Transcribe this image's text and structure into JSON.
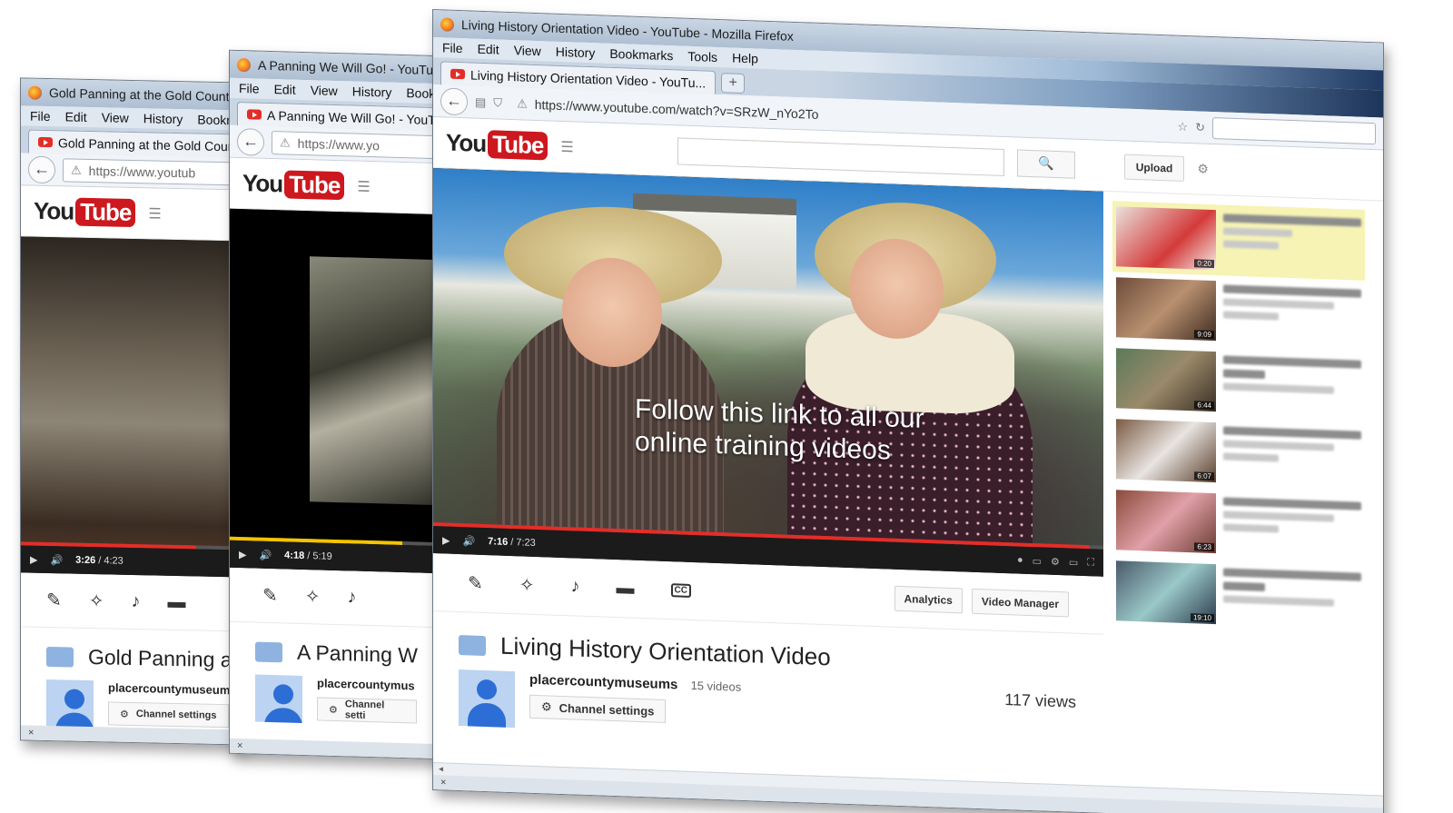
{
  "colors": {
    "youtube_red": "#e52d27",
    "titlebar": "#bfcfe1",
    "accent_blue": "#2c6ed5"
  },
  "menu": [
    "File",
    "Edit",
    "View",
    "History",
    "Bookmarks",
    "Tools",
    "Help"
  ],
  "youtube_logo": {
    "you": "You",
    "tube": "Tube"
  },
  "back_window_1": {
    "window_title": "Gold Panning at the Gold Country -",
    "menu": [
      "File",
      "Edit",
      "View",
      "History",
      "Bookmark"
    ],
    "tab_title": "Gold Panning at the Gold Country",
    "url": "https://www.youtub",
    "time_current": "3:26",
    "time_total": "/ 4:23",
    "progress_fraction": 0.78,
    "video_title": "Gold Panning a",
    "channel_name": "placercountymuseum",
    "channel_settings": "Channel settings"
  },
  "back_window_2": {
    "window_title": "A Panning We Will Go! - YouTub",
    "menu": [
      "File",
      "Edit",
      "View",
      "History",
      "Bookr"
    ],
    "tab_title": "A Panning We Will Go! - YouTu",
    "url": "https://www.yo",
    "time_current": "4:18",
    "time_total": "/ 5:19",
    "progress_fraction": 0.81,
    "video_title": "A Panning W",
    "channel_name": "placercountymus",
    "channel_settings": "Channel setti"
  },
  "front_window": {
    "window_title": "Living History Orientation Video - YouTube - Mozilla Firefox",
    "tab_title": "Living History Orientation Video - YouTu...",
    "new_tab": "+",
    "url": "https://www.youtube.com/watch?v=SRzW_nYo2To",
    "upload_label": "Upload",
    "video_overlay": [
      "Follow this link to all our",
      "online training videos"
    ],
    "time_current": "7:16",
    "time_total": "/ 7:23",
    "progress_fraction": 0.98,
    "analytics_label": "Analytics",
    "video_manager_label": "Video Manager",
    "cc_label": "CC",
    "video_title": "Living History Orientation Video",
    "channel_name": "placercountymuseums",
    "video_count": "15 videos",
    "channel_settings": "Channel settings",
    "views": "117 views",
    "status_close": "×",
    "related_durations": [
      "0:20",
      "9:09",
      "6:44",
      "6:07",
      "6:23",
      "19:10",
      ""
    ]
  }
}
